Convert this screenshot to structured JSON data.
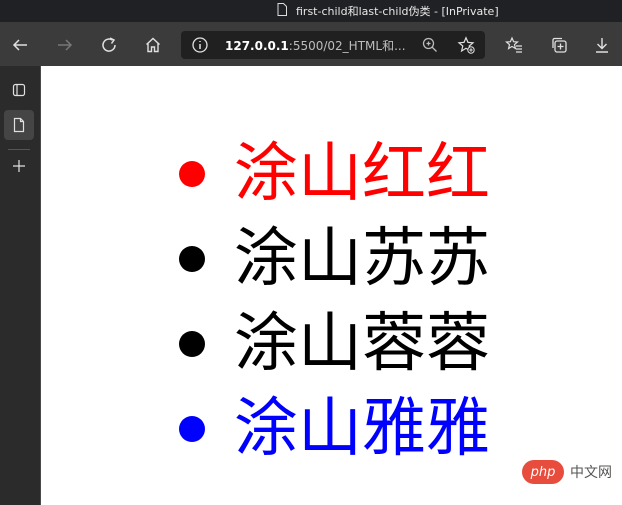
{
  "window": {
    "title": "first-child和last-child伪类 - [InPrivate]"
  },
  "toolbar": {
    "url_host": "127.0.0.1",
    "url_rest": ":5500/02_HTML和..."
  },
  "list": {
    "items": [
      {
        "text": "涂山红红",
        "color": "#ff0000"
      },
      {
        "text": "涂山苏苏",
        "color": "#000000"
      },
      {
        "text": "涂山蓉蓉",
        "color": "#000000"
      },
      {
        "text": "涂山雅雅",
        "color": "#0000ff"
      }
    ]
  },
  "watermark": {
    "logo": "php",
    "text": "中文网"
  },
  "icons": [
    "document-icon",
    "back-icon",
    "forward-icon",
    "refresh-icon",
    "home-icon",
    "info-icon",
    "zoom-icon",
    "add-favorite-icon",
    "favorites-icon",
    "collections-icon",
    "download-icon",
    "tabs-icon",
    "page-icon",
    "add-icon"
  ]
}
